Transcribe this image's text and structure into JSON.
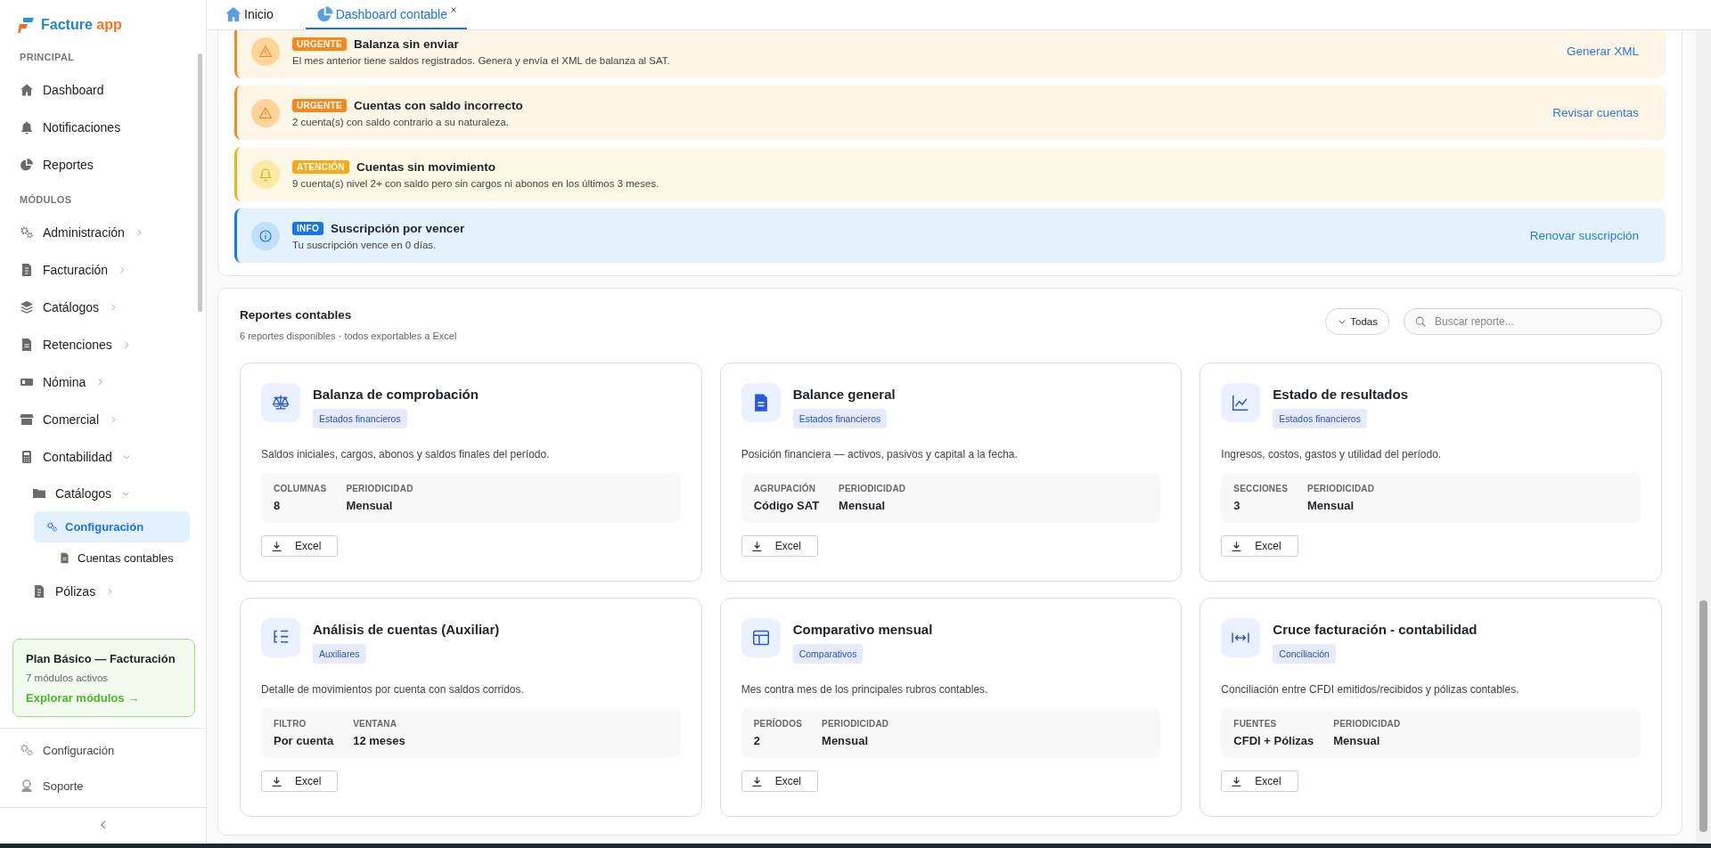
{
  "sidebar": {
    "logo": {
      "name": "Facture",
      "suffix": "app"
    },
    "sections": [
      {
        "title": "PRINCIPAL",
        "items": [
          {
            "label": "Dashboard",
            "selected": false
          },
          {
            "label": "Notificaciones",
            "selected": false
          },
          {
            "label": "Reportes",
            "selected": false
          }
        ]
      },
      {
        "title": "MÓDULOS",
        "items": [
          {
            "label": "Administración",
            "selected": false,
            "expanded": false
          },
          {
            "label": "Facturación",
            "selected": false,
            "expanded": false
          },
          {
            "label": "Catálogos",
            "selected": false,
            "expanded": false
          },
          {
            "label": "Retenciones",
            "selected": false,
            "expanded": false
          },
          {
            "label": "Nómina",
            "selected": false,
            "expanded": false
          },
          {
            "label": "Comercial",
            "selected": false,
            "expanded": false
          },
          {
            "label": "Contabilidad",
            "selected": false,
            "expanded": true,
            "children": [
              {
                "label": "Catálogos",
                "selected": false,
                "expanded": true,
                "children": [
                  {
                    "label": "Configuración",
                    "selected": true
                  },
                  {
                    "label": "Cuentas contables",
                    "selected": false
                  }
                ]
              },
              {
                "label": "Pólizas",
                "selected": false,
                "expanded": false
              }
            ]
          }
        ]
      }
    ],
    "plan": {
      "title": "Plan Básico — Facturación",
      "subtitle": "7 módulos activos",
      "link": "Explorar módulos →"
    },
    "footer": [
      {
        "label": "Configuración",
        "selected": false
      },
      {
        "label": "Soporte",
        "selected": false
      }
    ]
  },
  "tabs": [
    {
      "label": "Inicio",
      "selected": false,
      "closable": false
    },
    {
      "label": "Dashboard contable",
      "selected": true,
      "closable": true
    }
  ],
  "alerts": [
    {
      "kind": "urgent",
      "badge": "URGENTE",
      "title": "Balanza sin enviar",
      "message": "El mes anterior tiene saldos registrados. Genera y envía el XML de balanza al SAT.",
      "action": "Generar XML"
    },
    {
      "kind": "urgent",
      "badge": "URGENTE",
      "title": "Cuentas con saldo incorrecto",
      "message": "2 cuenta(s) con saldo contrario a su naturaleza.",
      "action": "Revisar cuentas"
    },
    {
      "kind": "attention",
      "badge": "ATENCIÓN",
      "title": "Cuentas sin movimiento",
      "message": "9 cuenta(s) nivel 2+ con saldo pero sin cargos ni abonos en los últimos 3 meses."
    },
    {
      "kind": "info",
      "badge": "INFO",
      "title": "Suscripción por vencer",
      "message": "Tu suscripción vence en 0 días.",
      "action": "Renovar suscripción"
    }
  ],
  "reports": {
    "title": "Reportes contables",
    "subtitle": "6 reportes disponibles · todos exportables a Excel",
    "filter": "Todas",
    "search": {
      "placeholder": "Buscar reporte..."
    },
    "cards": [
      {
        "title": "Balanza de comprobación",
        "tag": "Estados financieros",
        "description": "Saldos iniciales, cargos, abonos y saldos finales del período.",
        "fields": [
          {
            "label": "COLUMNAS",
            "value": "8"
          },
          {
            "label": "PERIODICIDAD",
            "value": "Mensual"
          }
        ],
        "button": "Excel"
      },
      {
        "title": "Balance general",
        "tag": "Estados financieros",
        "description": "Posición financiera — activos, pasivos y capital a la fecha.",
        "fields": [
          {
            "label": "AGRUPACIÓN",
            "value": "Código SAT"
          },
          {
            "label": "PERIODICIDAD",
            "value": "Mensual"
          }
        ],
        "button": "Excel"
      },
      {
        "title": "Estado de resultados",
        "tag": "Estados financieros",
        "description": "Ingresos, costos, gastos y utilidad del período.",
        "fields": [
          {
            "label": "SECCIONES",
            "value": "3"
          },
          {
            "label": "PERIODICIDAD",
            "value": "Mensual"
          }
        ],
        "button": "Excel"
      },
      {
        "title": "Análisis de cuentas (Auxiliar)",
        "tag": "Auxiliares",
        "description": "Detalle de movimientos por cuenta con saldos corridos.",
        "fields": [
          {
            "label": "FILTRO",
            "value": "Por cuenta"
          },
          {
            "label": "VENTANA",
            "value": "12 meses"
          }
        ],
        "button": "Excel"
      },
      {
        "title": "Comparativo mensual",
        "tag": "Comparativos",
        "description": "Mes contra mes de los principales rubros contables.",
        "fields": [
          {
            "label": "PERÍODOS",
            "value": "2"
          },
          {
            "label": "PERIODICIDAD",
            "value": "Mensual"
          }
        ],
        "button": "Excel"
      },
      {
        "title": "Cruce facturación - contabilidad",
        "tag": "Conciliación",
        "description": "Conciliación entre CFDI emitidos/recibidos y pólizas contables.",
        "fields": [
          {
            "label": "FUENTES",
            "value": "CFDI + Pólizas"
          },
          {
            "label": "PERIODICIDAD",
            "value": "Mensual"
          }
        ],
        "button": "Excel"
      }
    ]
  }
}
